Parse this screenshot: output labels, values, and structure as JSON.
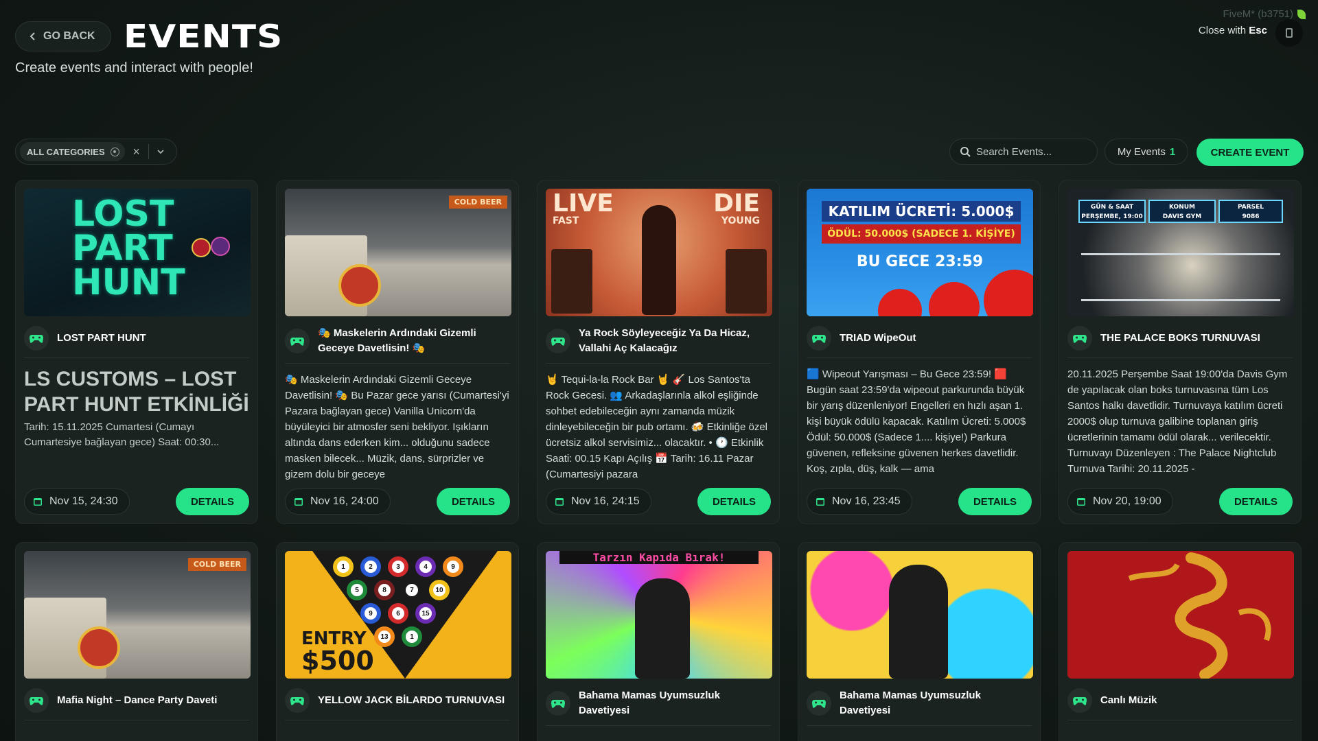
{
  "header": {
    "back_label": "GO BACK",
    "title": "EVENTS",
    "subtitle": "Create events and interact with people!",
    "fivem_label": "FiveM* (b3751)",
    "close_label": "Close with",
    "close_key": "Esc"
  },
  "filters": {
    "category_label": "ALL CATEGORIES",
    "clear_symbol": "×",
    "search_placeholder": "Search Events...",
    "my_events_label": "My Events",
    "my_events_count": "1",
    "create_label": "CREATE EVENT"
  },
  "colors": {
    "accent": "#26e38a",
    "background": "#121a17",
    "card": "#1a2320"
  },
  "icons": {
    "event_icon": "gamepad-icon",
    "date_icon": "calendar-icon",
    "search_icon": "search-icon"
  },
  "events": [
    {
      "title": "LOST PART HUNT",
      "desc_heading": "LS CUSTOMS – LOST PART HUNT ETKİNLİĞİ",
      "desc": "Tarih: 15.11.2025 Cumartesi (Cumayı Cumartesiye bağlayan gece) Saat: 00:30...",
      "date": "Nov 15, 24:30",
      "details_label": "DETAILS",
      "image_text": {
        "line1": "LOST",
        "line2": "PART",
        "line3": "HUNT"
      }
    },
    {
      "title": "🎭 Maskelerin Ardındaki Gizemli Geceye Davetlisin! 🎭",
      "desc": "🎭 Maskelerin Ardındaki Gizemli Geceye Davetlisin! 🎭 Bu Pazar gece yarısı (Cumartesi'yi Pazara bağlayan gece) Vanilla Unicorn'da büyüleyici bir atmosfer seni bekliyor. Işıkların altında dans ederken kim... olduğunu sadece masken bilecek... Müzik, dans, sürprizler ve gizem dolu bir geceye",
      "date": "Nov 16, 24:00",
      "details_label": "DETAILS",
      "image_text": {
        "sign": "COLD BEER"
      }
    },
    {
      "title": "Ya Rock Söyleyeceğiz Ya Da Hicaz, Vallahi Aç Kalacağız",
      "desc": "🤘 Tequi-la-la Rock Bar 🤘 🎸 Los Santos'ta Rock Gecesi. 👥 Arkadaşlarınla alkol eşliğinde sohbet edebileceğin aynı zamanda müzik dinleyebileceğin bir pub ortamı. 🍻 Etkinliğe özel ücretsiz alkol servisimiz... olacaktır. • 🕐 Etkinlik Saati: 00.15 Kapı Açılış 📅 Tarih: 16.11 Pazar (Cumartesiyi pazara",
      "date": "Nov 16, 24:15",
      "details_label": "DETAILS",
      "image_text": {
        "left_big": "LIVE",
        "left_small": "FAST",
        "right_big": "DIE",
        "right_small": "YOUNG"
      }
    },
    {
      "title": "TRIAD WipeOut",
      "desc": "🟦 Wipeout Yarışması – Bu Gece 23:59! 🟥 Bugün saat 23:59'da wipeout parkurunda büyük bir yarış düzenleniyor! Engelleri en hızlı aşan 1. kişi büyük ödülü kapacak. Katılım Ücreti: 5.000$ Ödül: 50.000$ (Sadece 1.... kişiye!) Parkura güvenen, refleksine güvenen herkes davetlidir. Koş, zıpla, düş, kalk — ama",
      "date": "Nov 16, 23:45",
      "details_label": "DETAILS",
      "image_text": {
        "line1": "KATILIM ÜCRETİ: 5.000$",
        "line2": "ÖDÜL: 50.000$ (SADECE 1. KİŞİYE)",
        "line3": "BU GECE 23:59"
      }
    },
    {
      "title": "THE PALACE BOKS TURNUVASI",
      "desc": "20.11.2025 Perşembe Saat 19:00'da Davis Gym de yapılacak olan boks turnuvasına tüm Los Santos halkı davetlidir. Turnuvaya katılım ücreti 2000$ olup turnuva galibine toplanan giriş ücretlerinin tamamı ödül olarak... verilecektir. Turnuvayı Düzenleyen : The Palace Nightclub Turnuva Tarihi: 20.11.2025 -",
      "date": "Nov 20, 19:00",
      "details_label": "DETAILS",
      "image_text": {
        "b1a": "GÜN & SAAT",
        "b1b": "PERŞEMBE, 19:00",
        "b2a": "KONUM",
        "b2b": "DAVIS GYM",
        "b3a": "PARSEL",
        "b3b": "9086"
      }
    },
    {
      "title": "Mafia Night – Dance Party Daveti",
      "image_text": {
        "sign": "COLD BEER"
      }
    },
    {
      "title": "YELLOW JACK BİLARDO TURNUVASI",
      "image_text": {
        "entry": "ENTRY",
        "price": "$500"
      },
      "balls": [
        "1",
        "2",
        "3",
        "4",
        "9",
        "5",
        "8",
        "7",
        "10",
        "9",
        "6",
        "15",
        "13",
        "1"
      ]
    },
    {
      "title": "Bahama Mamas Uyumsuzluk Davetiyesi",
      "image_text": {
        "banner": "Tarzın Kapıda Bırak!"
      }
    },
    {
      "title": "Bahama Mamas Uyumsuzluk Davetiyesi"
    },
    {
      "title": "Canlı Müzik"
    }
  ]
}
